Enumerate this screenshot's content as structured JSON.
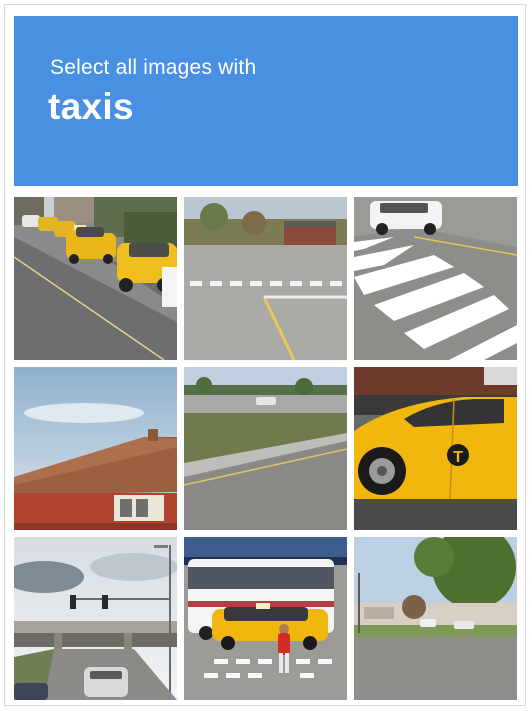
{
  "header": {
    "line1": "Select all images with",
    "line2": "taxis"
  },
  "grid": {
    "rows": 3,
    "columns": 3,
    "tiles": [
      {
        "row": 1,
        "col": 1,
        "content": "street with row of parked yellow taxis"
      },
      {
        "row": 1,
        "col": 2,
        "content": "empty parking lot with road markings"
      },
      {
        "row": 1,
        "col": 3,
        "content": "crosswalk with white SUV"
      },
      {
        "row": 2,
        "col": 1,
        "content": "brown roof of brick building"
      },
      {
        "row": 2,
        "col": 2,
        "content": "road with grassy median"
      },
      {
        "row": 2,
        "col": 3,
        "content": "close-up of yellow taxi"
      },
      {
        "row": 3,
        "col": 1,
        "content": "overpass with traffic lights"
      },
      {
        "row": 3,
        "col": 2,
        "content": "yellow taxi and white bus at crosswalk"
      },
      {
        "row": 3,
        "col": 3,
        "content": "road with trees and buildings"
      }
    ]
  },
  "colors": {
    "header_bg": "#4a90e2",
    "header_text": "#ffffff",
    "taxi": "#f2b70f"
  }
}
